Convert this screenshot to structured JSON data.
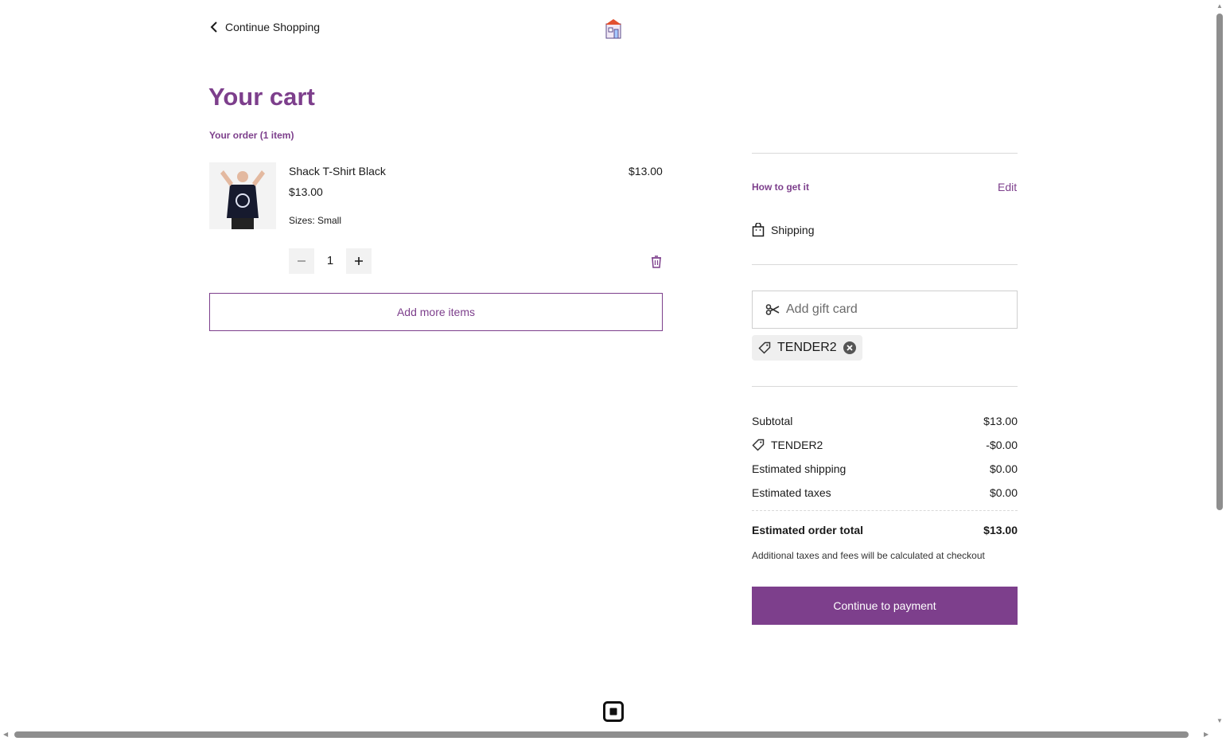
{
  "header": {
    "back_label": "Continue Shopping"
  },
  "cart": {
    "title": "Your cart",
    "order_count": "Your order (1 item)",
    "item": {
      "name": "Shack T-Shirt Black",
      "unit_price": "$13.00",
      "size": "Sizes: Small",
      "line_total": "$13.00",
      "quantity": "1"
    },
    "add_more_label": "Add more items"
  },
  "fulfillment": {
    "label": "How to get it",
    "edit_label": "Edit",
    "method": "Shipping"
  },
  "gift_card": {
    "placeholder": "Add gift card"
  },
  "coupon": {
    "code": "TENDER2"
  },
  "summary": {
    "subtotal_label": "Subtotal",
    "subtotal_value": "$13.00",
    "discount_label": "TENDER2",
    "discount_value": "-$0.00",
    "shipping_label": "Estimated shipping",
    "shipping_value": "$0.00",
    "taxes_label": "Estimated taxes",
    "taxes_value": "$0.00",
    "total_label": "Estimated order total",
    "total_value": "$13.00",
    "note": "Additional taxes and fees will be calculated at checkout"
  },
  "pay_button": "Continue to payment",
  "colors": {
    "brand": "#7d3f8c"
  }
}
